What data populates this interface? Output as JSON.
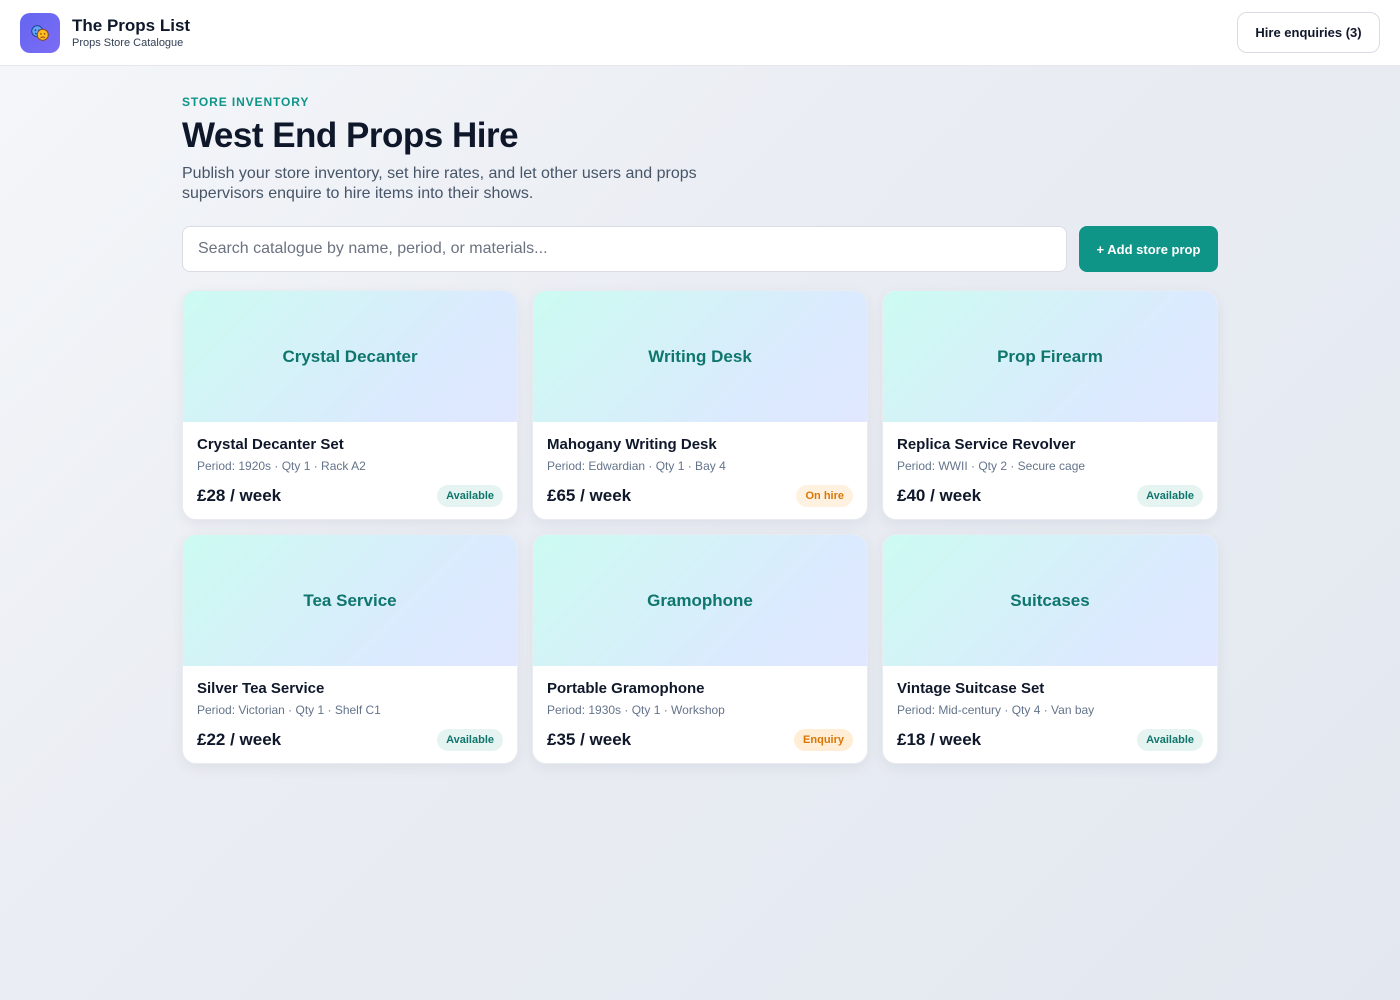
{
  "app": {
    "title": "The Props List",
    "subtitle": "Props Store Catalogue",
    "logo_icon": "theatre-masks-icon"
  },
  "header": {
    "hire_enquiries_label": "Hire enquiries (3)"
  },
  "page": {
    "eyebrow": "STORE INVENTORY",
    "title": "West End Props Hire",
    "description": "Publish your store inventory, set hire rates, and let other users and props supervisors enquire to hire items into their shows."
  },
  "search": {
    "placeholder": "Search catalogue by name, period, or materials...",
    "value": ""
  },
  "actions": {
    "add_label": "+ Add store prop"
  },
  "colors": {
    "accent": "#0f9488",
    "logo": "#6366f1",
    "available": "#0f766e",
    "warning": "#d97706"
  },
  "cards": [
    {
      "hero": "Crystal Decanter",
      "name": "Crystal Decanter Set",
      "meta": "Period: 1920s · Qty 1 · Rack A2",
      "price": "£28 / week",
      "status": "Available",
      "status_kind": "available"
    },
    {
      "hero": "Writing Desk",
      "name": "Mahogany Writing Desk",
      "meta": "Period: Edwardian · Qty 1 · Bay 4",
      "price": "£65 / week",
      "status": "On hire",
      "status_kind": "onhire"
    },
    {
      "hero": "Prop Firearm",
      "name": "Replica Service Revolver",
      "meta": "Period: WWII · Qty 2 · Secure cage",
      "price": "£40 / week",
      "status": "Available",
      "status_kind": "available"
    },
    {
      "hero": "Tea Service",
      "name": "Silver Tea Service",
      "meta": "Period: Victorian · Qty 1 · Shelf C1",
      "price": "£22 / week",
      "status": "Available",
      "status_kind": "available"
    },
    {
      "hero": "Gramophone",
      "name": "Portable Gramophone",
      "meta": "Period: 1930s · Qty 1 · Workshop",
      "price": "£35 / week",
      "status": "Enquiry",
      "status_kind": "enquiry"
    },
    {
      "hero": "Suitcases",
      "name": "Vintage Suitcase Set",
      "meta": "Period: Mid-century · Qty 4 · Van bay",
      "price": "£18 / week",
      "status": "Available",
      "status_kind": "available"
    }
  ]
}
